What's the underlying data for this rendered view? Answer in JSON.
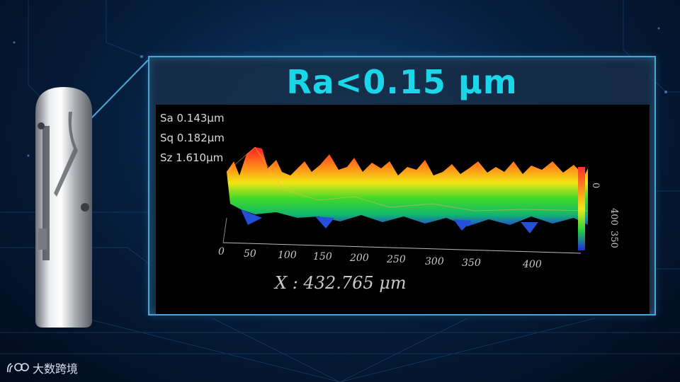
{
  "title": "Ra<0.15 μm",
  "stats": {
    "sa": "Sa 0.143μm",
    "sq": "Sq 0.182μm",
    "sz": "Sz 1.610μm"
  },
  "x_axis": {
    "label": "X : 432.765 μm",
    "ticks": [
      "0",
      "50",
      "100",
      "150",
      "200",
      "250",
      "300",
      "350",
      "400"
    ]
  },
  "colorbar_ticks": [
    "0",
    "350",
    "400"
  ],
  "logo_text": "大数跨境",
  "colors": {
    "title": "#19d6e8",
    "panel_border": "#4aa6d6"
  }
}
